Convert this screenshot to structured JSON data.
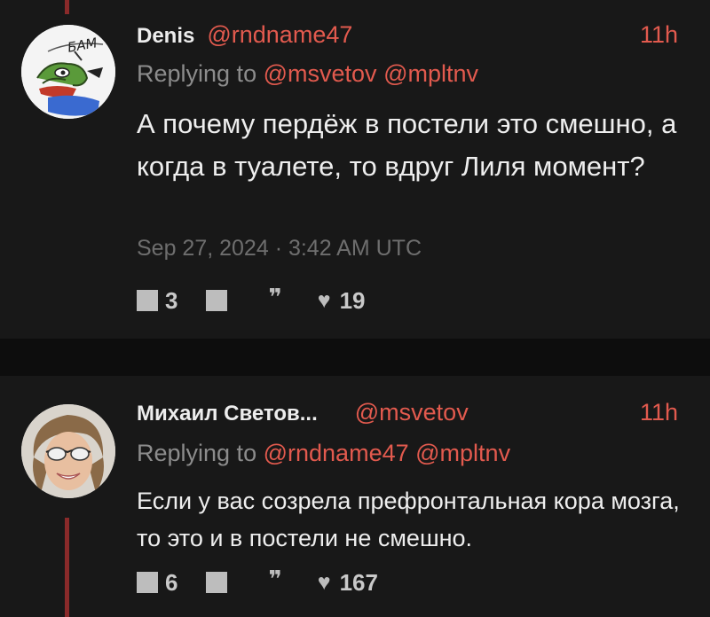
{
  "tweets": [
    {
      "display_name": "Denis",
      "handle": "@rndname47",
      "time": "11h",
      "replying_prefix": "Replying to",
      "replying_mentions": [
        "@msvetov",
        "@mpltnv"
      ],
      "content": "А почему пердёж в постели это смешно, а когда в туалете, то вдруг Лиля момент?",
      "date": "Sep 27, 2024 · 3:42 AM UTC",
      "stats": {
        "replies": "3",
        "likes": "19"
      },
      "avatar_text": "БАМ"
    },
    {
      "display_name": "Михаил Светов...",
      "handle": "@msvetov",
      "time": "11h",
      "replying_prefix": "Replying to",
      "replying_mentions": [
        "@rndname47",
        "@mpltnv"
      ],
      "content": "Если у вас созрела префронтальная кора мозга, то это и в постели не смешно.",
      "stats": {
        "replies": "6",
        "likes": "167"
      }
    }
  ],
  "icons": {
    "reply": "reply-icon",
    "retweet": "retweet-icon",
    "quote": "quote-icon",
    "like": "heart-icon"
  },
  "colors": {
    "background": "#181818",
    "separator": "#0d0d0d",
    "accent": "#e25a4e",
    "thread_line": "#8a2a2a",
    "muted": "#8c8c8c"
  }
}
